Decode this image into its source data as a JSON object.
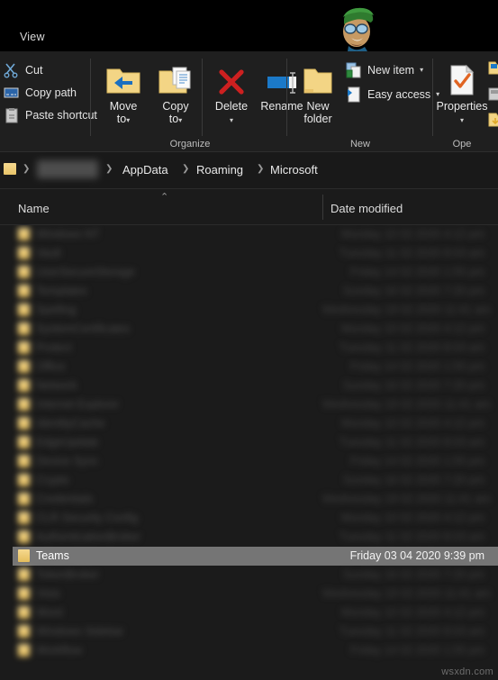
{
  "window": {
    "active_tab": "View",
    "avatar_alt": "user-avatar-cartoon"
  },
  "ribbon": {
    "clipboard": {
      "commands": [
        {
          "label": "Cut",
          "icon": "scissors-icon"
        },
        {
          "label": "Copy path",
          "icon": "copy-path-icon"
        },
        {
          "label": "Paste shortcut",
          "icon": "paste-shortcut-icon"
        }
      ]
    },
    "organize": {
      "group_label": "Organize",
      "buttons": [
        {
          "line1": "Move",
          "line2": "to",
          "caret": "▾",
          "icon": "move-to-folder-icon"
        },
        {
          "line1": "Copy",
          "line2": "to",
          "caret": "▾",
          "icon": "copy-to-folder-icon"
        },
        {
          "line1": "Delete",
          "line2": "",
          "caret": "▾",
          "icon": "delete-x-icon"
        },
        {
          "line1": "Rename",
          "line2": "",
          "caret": "",
          "icon": "rename-icon"
        }
      ]
    },
    "new": {
      "group_label": "New",
      "big_button": {
        "line1": "New",
        "line2": "folder",
        "icon": "new-folder-icon"
      },
      "commands": [
        {
          "label": "New item",
          "caret": "▾",
          "icon": "new-item-icon"
        },
        {
          "label": "Easy access",
          "caret": "▾",
          "icon": "easy-access-icon"
        }
      ]
    },
    "open": {
      "group_label": "Ope",
      "properties": {
        "label": "Properties",
        "caret": "▾",
        "icon": "properties-icon"
      }
    }
  },
  "breadcrumb": {
    "root_icon": "folder-icon",
    "separator": "❯",
    "items": [
      {
        "label": "",
        "redacted": true
      },
      {
        "label": "AppData",
        "redacted": false
      },
      {
        "label": "Roaming",
        "redacted": false
      },
      {
        "label": "Microsoft",
        "redacted": false
      }
    ]
  },
  "file_list": {
    "columns": [
      {
        "label": "Name",
        "sorted": "ascending",
        "sort_glyph": "⌃"
      },
      {
        "label": "Date modified",
        "sorted": "none",
        "sort_glyph": ""
      }
    ],
    "rows": [
      {
        "name": "",
        "date": "",
        "redacted": true,
        "selected": false
      },
      {
        "name": "",
        "date": "",
        "redacted": true,
        "selected": false
      },
      {
        "name": "",
        "date": "",
        "redacted": true,
        "selected": false
      },
      {
        "name": "",
        "date": "",
        "redacted": true,
        "selected": false
      },
      {
        "name": "",
        "date": "",
        "redacted": true,
        "selected": false
      },
      {
        "name": "",
        "date": "",
        "redacted": true,
        "selected": false
      },
      {
        "name": "",
        "date": "",
        "redacted": true,
        "selected": false
      },
      {
        "name": "",
        "date": "",
        "redacted": true,
        "selected": false
      },
      {
        "name": "",
        "date": "",
        "redacted": true,
        "selected": false
      },
      {
        "name": "",
        "date": "",
        "redacted": true,
        "selected": false
      },
      {
        "name": "",
        "date": "",
        "redacted": true,
        "selected": false
      },
      {
        "name": "",
        "date": "",
        "redacted": true,
        "selected": false
      },
      {
        "name": "",
        "date": "",
        "redacted": true,
        "selected": false
      },
      {
        "name": "",
        "date": "",
        "redacted": true,
        "selected": false
      },
      {
        "name": "",
        "date": "",
        "redacted": true,
        "selected": false
      },
      {
        "name": "",
        "date": "",
        "redacted": true,
        "selected": false
      },
      {
        "name": "",
        "date": "",
        "redacted": true,
        "selected": false
      },
      {
        "name": "Teams",
        "date": "Friday 03 04 2020 9:39 pm",
        "redacted": false,
        "selected": true
      },
      {
        "name": "",
        "date": "",
        "redacted": true,
        "selected": false
      },
      {
        "name": "",
        "date": "",
        "redacted": true,
        "selected": false
      },
      {
        "name": "",
        "date": "",
        "redacted": true,
        "selected": false
      },
      {
        "name": "",
        "date": "",
        "redacted": true,
        "selected": false
      },
      {
        "name": "",
        "date": "",
        "redacted": true,
        "selected": false
      }
    ]
  },
  "watermark": "wsxdn.com",
  "colors": {
    "window_bg": "#1b1b1b",
    "ribbon_bg": "#1f1f1f",
    "title_bg": "#000000",
    "selection": "#757575",
    "folder_yellow": "#f0cd74",
    "delete_red": "#cc2222",
    "accent_blue": "#1b79c8",
    "text": "#e6e6e6"
  }
}
